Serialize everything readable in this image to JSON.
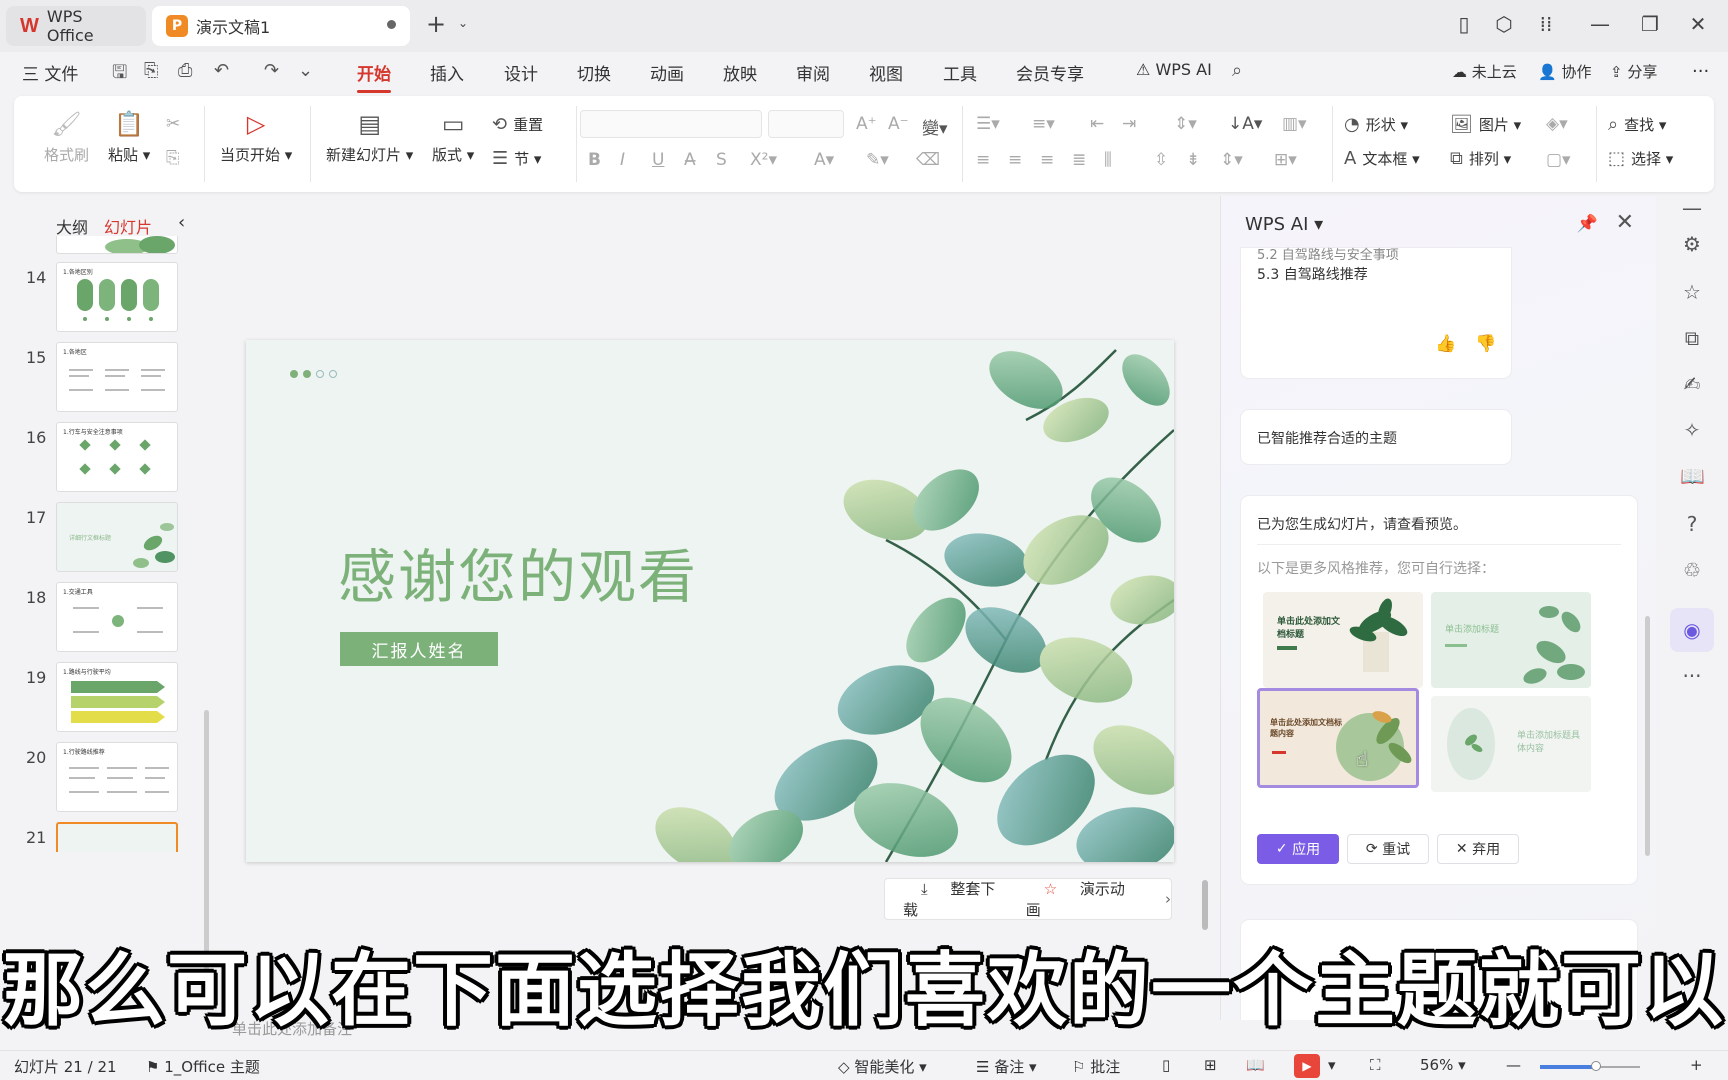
{
  "titlebar": {
    "app_name": "WPS Office",
    "doc_tab": "演示文稿1",
    "doc_icon_letter": "P"
  },
  "menubar": {
    "file": "三 文件",
    "items": [
      "开始",
      "插入",
      "设计",
      "切换",
      "动画",
      "放映",
      "审阅",
      "视图",
      "工具",
      "会员专享"
    ],
    "active": "开始",
    "wps_ai": "WPS AI",
    "cloud": "未上云",
    "collab": "协作",
    "share": "分享"
  },
  "ribbon": {
    "format_painter": "格式刷",
    "paste": "粘贴",
    "from_current": "当页开始",
    "new_slide": "新建幻灯片",
    "layout": "版式",
    "reset": "重置",
    "section": "节",
    "shape": "形状",
    "picture": "图片",
    "textbox": "文本框",
    "arrange": "排列",
    "find": "查找",
    "select": "选择"
  },
  "leftpane": {
    "tab_outline": "大纲",
    "tab_slides": "幻灯片",
    "thumbs": [
      {
        "num": "14",
        "title": "1.各地区别"
      },
      {
        "num": "15",
        "title": "1.各地区"
      },
      {
        "num": "16",
        "title": "1.行车与安全注意事项"
      },
      {
        "num": "17",
        "title": "详细行文框标题"
      },
      {
        "num": "18",
        "title": "1.交通工具"
      },
      {
        "num": "19",
        "title": "1.路线与行驶平均"
      },
      {
        "num": "20",
        "title": "1.行驶路线推荐"
      },
      {
        "num": "21",
        "title": ""
      }
    ]
  },
  "slide": {
    "title": "感谢您的观看",
    "reporter": "汇报人姓名",
    "download": "整套下载",
    "animation": "演示动画",
    "notes_placeholder": "单击此处添加备注"
  },
  "aipanel": {
    "title": "WPS AI",
    "partial_line": "5.2 自驾路线与安全事项",
    "route_line": "5.3 自驾路线推荐",
    "recommended": "已智能推荐合适的主题",
    "generated": "已为您生成幻灯片，请查看预览。",
    "more_styles": "以下是更多风格推荐，您可自行选择：",
    "themes": [
      {
        "text": "单击此处添加文档标题"
      },
      {
        "text": "单击添加标题"
      },
      {
        "text": "单击此处添加文档标题内容"
      },
      {
        "text": "单击添加标题具体内容"
      }
    ],
    "apply": "应用",
    "retry": "重试",
    "discard": "弃用"
  },
  "statusbar": {
    "slide_count": "幻灯片 21 / 21",
    "theme": "1_Office 主题",
    "beautify": "智能美化",
    "notes": "备注",
    "comments": "批注",
    "zoom": "56%",
    "zoom_fraction": 0.56
  },
  "subtitle": "那么可以在下面选择我们喜欢的一个主题就可以",
  "colors": {
    "accent": "#d6372d",
    "slide_green": "#7cb27a",
    "ai_purple": "#7b5ce6"
  }
}
